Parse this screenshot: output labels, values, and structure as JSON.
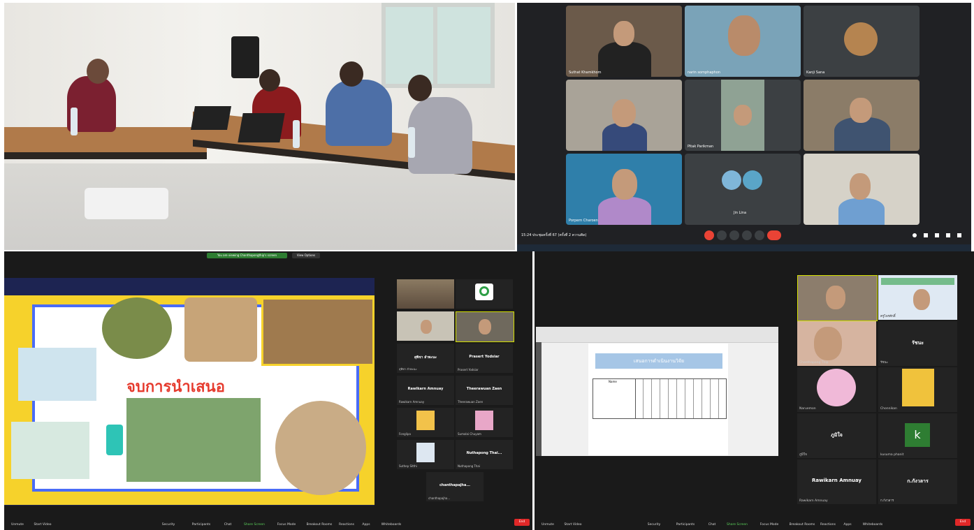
{
  "q2": {
    "tiles": [
      "Suthat Khamkhom",
      "narin somphaphon",
      "Kanji Sana",
      "",
      "Pitak Parikman",
      "",
      "Porpern Charoen",
      "Jin Lina",
      ""
    ],
    "status": "15:24   ประชุมครั้งที่ 67 (ครั้งที่ 2 ความคิด)"
  },
  "q3": {
    "topbar": "You are viewing Chanthapongthip's screen",
    "view_options": "View Options",
    "slide_text": "จบการนำเสนอ",
    "participants": [
      {
        "name": "",
        "sub": ""
      },
      {
        "name": "",
        "sub": ""
      },
      {
        "name": "",
        "sub": ""
      },
      {
        "name": "",
        "sub": ""
      },
      {
        "name": "สุพิชา ลำพะนะ",
        "sub": "สุพิชา ลำพะนะ"
      },
      {
        "name": "Prasert Yodsiar",
        "sub": "Prasert Yodsiar"
      },
      {
        "name": "Rawikarn Amnuay",
        "sub": "Rawikarn Amnuay"
      },
      {
        "name": "Theerawuan Zaen",
        "sub": "Theerawuan Zaen"
      },
      {
        "name": "",
        "sub": "Fonglipa"
      },
      {
        "name": "",
        "sub": "Sumalai Chuyam"
      },
      {
        "name": "",
        "sub": "Suthep Sitthi"
      },
      {
        "name": "Nuthapong Thai...",
        "sub": "Nuthapong Thai"
      },
      {
        "name": "chanthapajha...",
        "sub": "chanthapajha..."
      }
    ],
    "toolbar": [
      "Unmute",
      "Start Video",
      "Security",
      "Participants",
      "Chat",
      "Share Screen",
      "Focus Mode",
      "Breakout Rooms",
      "Reactions",
      "Apps",
      "Whiteboards"
    ],
    "end": "End"
  },
  "q4": {
    "doc_title": "เสนอการดำเนินงานวิจัย",
    "table_header": "Name",
    "grid": [
      {
        "name": "",
        "sub": ""
      },
      {
        "name": "",
        "sub": "ครูไพรศักดิ์"
      },
      {
        "name": "",
        "sub": "Chanthapong Thip"
      },
      {
        "name": "รัชนะ",
        "sub": "รัชนะ"
      },
      {
        "name": "",
        "sub": "Naruemon"
      },
      {
        "name": "",
        "sub": "Chonnikan"
      },
      {
        "name": "ภูมิใจ",
        "sub": "ภูมิใจ"
      },
      {
        "name": "k",
        "sub": "kusuma phanit"
      },
      {
        "name": "Rawikarn Amnuay",
        "sub": "Rawikarn Amnuay"
      },
      {
        "name": "ก.กังวลาร",
        "sub": "ก.กังวลาร"
      }
    ],
    "toolbar": [
      "Unmute",
      "Start Video",
      "Security",
      "Participants",
      "Chat",
      "Share Screen",
      "Focus Mode",
      "Breakout Rooms",
      "Reactions",
      "Apps",
      "Whiteboards"
    ],
    "end": "End"
  }
}
